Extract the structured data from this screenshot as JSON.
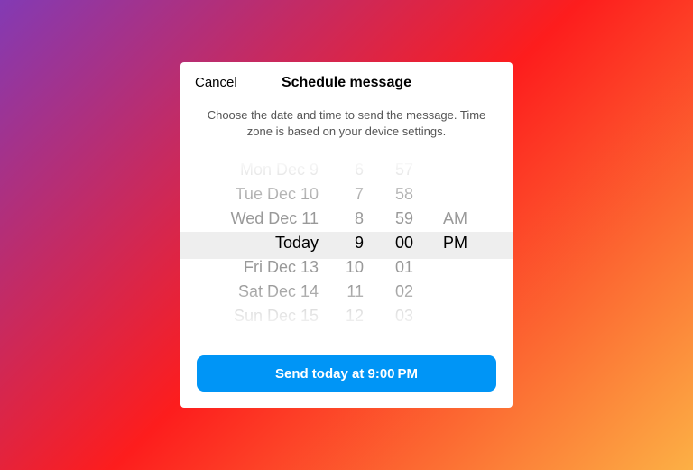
{
  "header": {
    "cancel": "Cancel",
    "title": "Schedule message"
  },
  "description": "Choose the date and time to send the message. Time zone is based on your device settings.",
  "picker": {
    "dates": [
      "Mon Dec 9",
      "Tue Dec 10",
      "Wed Dec 11",
      "Today",
      "Fri Dec 13",
      "Sat Dec 14",
      "Sun Dec 15"
    ],
    "hours": [
      "6",
      "7",
      "8",
      "9",
      "10",
      "11",
      "12"
    ],
    "minutes": [
      "57",
      "58",
      "59",
      "00",
      "01",
      "02",
      "03"
    ],
    "ampm": [
      "",
      "",
      "AM",
      "PM",
      "",
      "",
      ""
    ],
    "selectedIndex": 3
  },
  "footer": {
    "sendLabel": "Send today at 9:00 PM"
  }
}
